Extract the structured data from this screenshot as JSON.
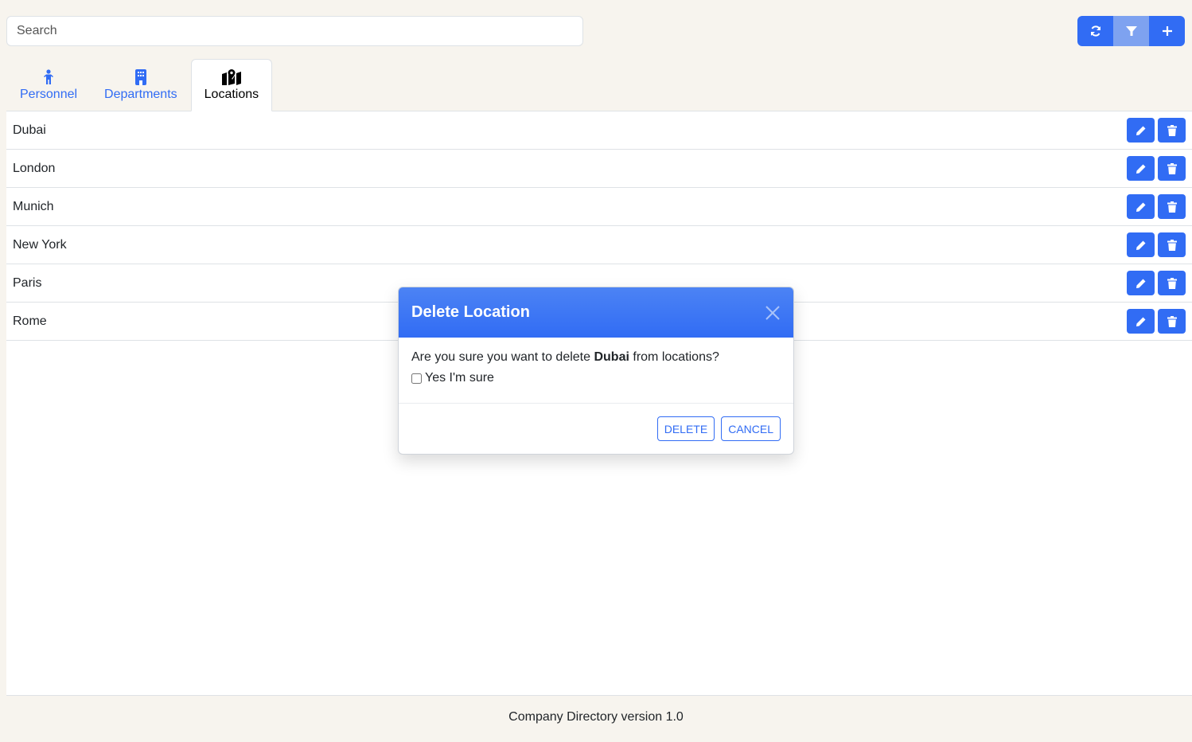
{
  "search": {
    "placeholder": "Search",
    "value": ""
  },
  "toolbar": {
    "buttons": [
      {
        "icon": "refresh-icon",
        "label": "Refresh"
      },
      {
        "icon": "filter-icon",
        "label": "Filter"
      },
      {
        "icon": "plus-icon",
        "label": "Add"
      }
    ]
  },
  "tabs": [
    {
      "label": "Personnel",
      "icon": "person-icon",
      "active": false
    },
    {
      "label": "Departments",
      "icon": "building-icon",
      "active": false
    },
    {
      "label": "Locations",
      "icon": "map-location-icon",
      "active": true
    }
  ],
  "locations": [
    {
      "name": "Dubai"
    },
    {
      "name": "London"
    },
    {
      "name": "Munich"
    },
    {
      "name": "New York"
    },
    {
      "name": "Paris"
    },
    {
      "name": "Rome"
    }
  ],
  "modal": {
    "title": "Delete Location",
    "message_prefix": "Are you sure you want to delete ",
    "message_target": "Dubai",
    "message_suffix": " from locations?",
    "checkbox_label": "Yes I'm sure",
    "delete_label": "DELETE",
    "cancel_label": "CANCEL"
  },
  "footer": {
    "text": "Company Directory version 1.0"
  },
  "colors": {
    "accent": "#316cf4",
    "background": "#f7f4ee"
  }
}
